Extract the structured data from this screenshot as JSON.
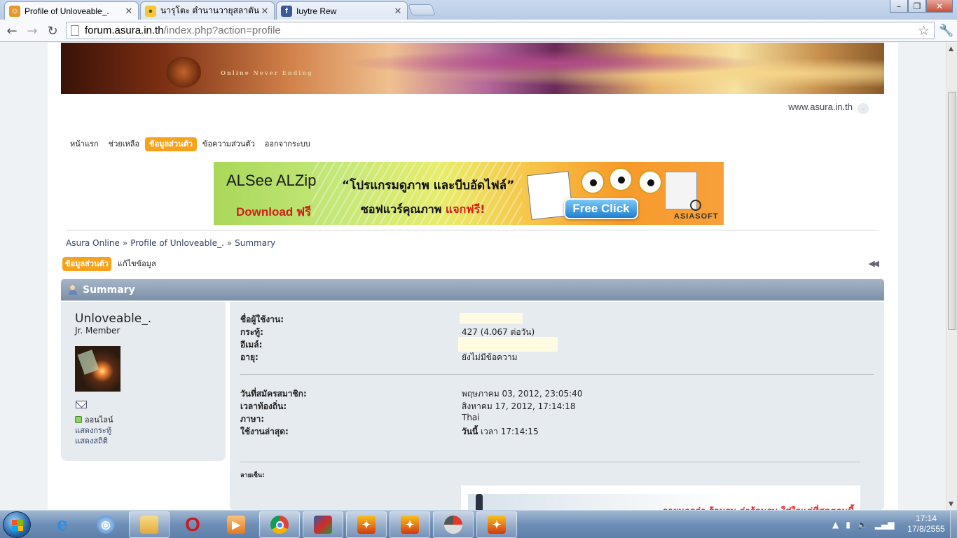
{
  "browser": {
    "tabs": [
      {
        "title": "Profile of Unloveable_.",
        "favicon": "orange-face-icon",
        "active": true
      },
      {
        "title": "นารุโตะ ตำนานวายุสลาตัน ตอน",
        "favicon": "bulb-icon",
        "active": false
      },
      {
        "title": "Iuytre Rew",
        "favicon": "facebook-icon",
        "active": false
      }
    ],
    "url_host": "forum.asura.in.th",
    "url_path": "/index.php?action=profile"
  },
  "site": {
    "banner_tagline": "Online Never Ending",
    "url_text": "www.asura.in.th"
  },
  "menu": [
    {
      "label": "หน้าแรก",
      "active": false
    },
    {
      "label": "ช่วยเหลือ",
      "active": false
    },
    {
      "label": "ข้อมูลส่วนตัว",
      "active": true
    },
    {
      "label": "ข้อความส่วนตัว",
      "active": false
    },
    {
      "label": "ออกจากระบบ",
      "active": false
    }
  ],
  "ad": {
    "title": "ALSee  ALZip",
    "slogan": "“โปรแกรมดูภาพ และบีบอัดไฟล์”",
    "download": "Download ฟรี",
    "sub": "ซอฟแวร์คุณภาพ",
    "sub_highlight": "แจกฟรี!",
    "button": "Free Click",
    "brand": "ASIASOFT"
  },
  "breadcrumb": [
    "Asura Online",
    "Profile of Unloveable_.",
    "Summary"
  ],
  "subtabs": [
    {
      "label": "ข้อมูลส่วนตัว",
      "active": true
    },
    {
      "label": "แก้ไขข้อมูล",
      "active": false
    }
  ],
  "section_title": "Summary",
  "profile": {
    "username": "Unloveable_.",
    "rank": "Jr. Member",
    "online": "ออนไลน์",
    "show_posts": "แสดงกระทู้",
    "show_stats": "แสดงสถิติ"
  },
  "details": {
    "group1": [
      {
        "key": "ชื่อผู้ใช้งาน:",
        "value": ""
      },
      {
        "key": "กระทู้:",
        "value": "427 (4.067 ต่อวัน)"
      },
      {
        "key": "อีเมล์:",
        "value": ""
      },
      {
        "key": "อายุ:",
        "value": "ยังไม่มีข้อความ"
      }
    ],
    "group2": [
      {
        "key": "วันที่สมัครสมาชิก:",
        "value": "พฤษภาคม 03, 2012, 23:05:40"
      },
      {
        "key": "เวลาท้องถิ่น:",
        "value": "สิงหาคม 17, 2012, 17:14:18"
      },
      {
        "key": "ภาษา:",
        "value": "Thai"
      },
      {
        "key": "ใช้งานล่าสุด:",
        "value_bold": "วันนี้",
        "value": " เวลา 17:14:15"
      }
    ],
    "signature_label": "ลายเซ็น:",
    "signature_text": "...ภายนอกว่า ร้อนรน จ่าร้อนรน ใส่ใจแค่ที่สุดตอนนี้"
  },
  "taskbar": {
    "time": "17:14",
    "date": "17/8/2555"
  },
  "colors": {
    "accent_orange": "#f7a21c",
    "catbar": "#8a9db3",
    "panel": "#e6ebf0",
    "link": "#334466"
  }
}
